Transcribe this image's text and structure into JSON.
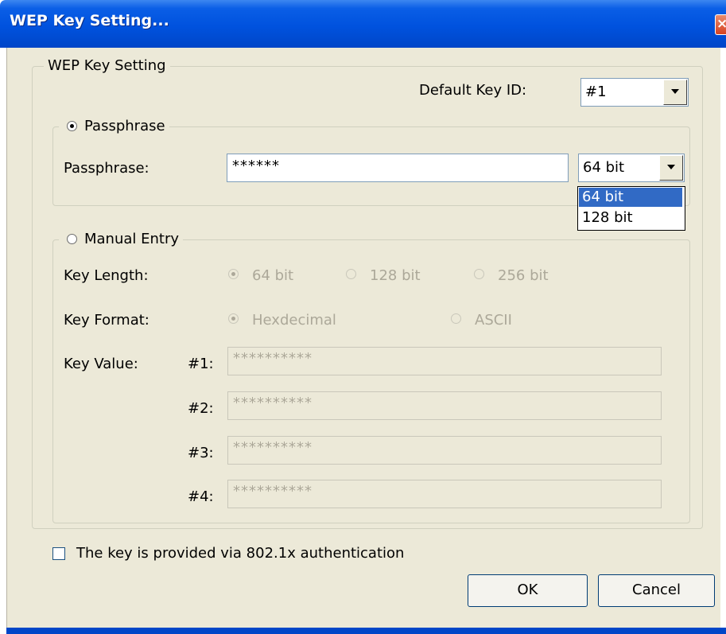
{
  "window": {
    "title": "WEP Key Setting...",
    "close_glyph": "×",
    "close_icon": "close-icon"
  },
  "group_main": {
    "legend": "WEP Key Setting"
  },
  "default_key": {
    "label": "Default Key ID:",
    "value": "#1"
  },
  "passphrase_group": {
    "radio_label": "Passphrase",
    "selected": true,
    "field_label": "Passphrase:",
    "field_value": "******",
    "bit_value": "64 bit",
    "dropdown_open": true,
    "options": [
      "64 bit",
      "128 bit"
    ],
    "highlighted_option": "64 bit"
  },
  "manual_group": {
    "radio_label": "Manual Entry",
    "selected": false,
    "key_length_label": "Key Length:",
    "key_length_options": [
      "64 bit",
      "128 bit",
      "256 bit"
    ],
    "key_length_selected": "64 bit",
    "key_format_label": "Key Format:",
    "key_format_options": [
      "Hexdecimal",
      "ASCII"
    ],
    "key_format_selected": "Hexdecimal",
    "key_value_label": "Key Value:",
    "keys": [
      {
        "label": "#1:",
        "value": "**********"
      },
      {
        "label": "#2:",
        "value": "**********"
      },
      {
        "label": "#3:",
        "value": "**********"
      },
      {
        "label": "#4:",
        "value": "**********"
      }
    ],
    "enabled": false
  },
  "auth_checkbox": {
    "label": "The key is provided via 802.1x authentication",
    "checked": false
  },
  "buttons": {
    "ok": "OK",
    "cancel": "Cancel"
  },
  "colors": {
    "title_bar": "#0052de",
    "dialog_bg": "#ece9d8",
    "selection": "#316ac5",
    "disabled_text": "#aca899"
  }
}
